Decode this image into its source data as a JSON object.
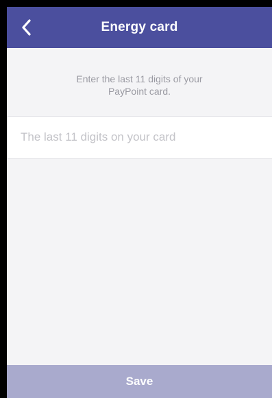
{
  "header": {
    "title": "Energy card",
    "back_icon": "chevron-left-icon"
  },
  "main": {
    "instruction_line1": "Enter the last 11 digits of your",
    "instruction_line2": "PayPoint card.",
    "card_input": {
      "value": "",
      "placeholder": "The last 11 digits on your card"
    }
  },
  "footer": {
    "save_label": "Save"
  },
  "colors": {
    "nav_background": "#4b4f9e",
    "page_background": "#f4f4f6",
    "save_button_disabled": "#a9aacd"
  }
}
